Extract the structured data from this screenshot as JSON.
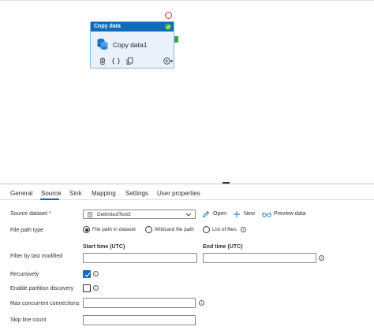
{
  "activity": {
    "type_label": "Copy data",
    "name": "Copy data1"
  },
  "tabs": [
    {
      "label": "General"
    },
    {
      "label": "Source"
    },
    {
      "label": "Sink"
    },
    {
      "label": "Mapping"
    },
    {
      "label": "Settings"
    },
    {
      "label": "User properties"
    }
  ],
  "active_tab": "Source",
  "source": {
    "dataset_label": "Source dataset",
    "required_mark": "*",
    "dataset_value": "DelimitedText3",
    "open_label": "Open",
    "new_label": "New",
    "preview_label": "Preview data",
    "file_path_type_label": "File path type",
    "file_path_options": [
      {
        "label": "File path in dataset",
        "checked": true
      },
      {
        "label": "Wildcard file path",
        "checked": false
      },
      {
        "label": "List of files",
        "checked": false
      }
    ],
    "filter_label": "Filter by last modified",
    "start_time_label": "Start time (UTC)",
    "end_time_label": "End time (UTC)",
    "start_time_value": "",
    "end_time_value": "",
    "recursively_label": "Recursively",
    "recursively_checked": true,
    "partition_discovery_label": "Enable partition discovery",
    "partition_discovery_checked": false,
    "max_connections_label": "Max concurrent connections",
    "max_connections_value": "",
    "skip_line_count_label": "Skip line count",
    "skip_line_count_value": ""
  },
  "colors": {
    "accent": "#0f6cbd",
    "success": "#3ea33e",
    "error_ring": "#d13438"
  },
  "icons": {
    "activity_check": "check-circle-icon",
    "activity": "copy-data-icon",
    "delete": "trash-icon",
    "code": "code-icon",
    "clone": "copy-icon",
    "add_output": "add-output-icon",
    "dataset": "dataset-icon",
    "open": "pencil-icon",
    "new": "plus-icon",
    "preview": "glasses-icon",
    "info": "info-icon",
    "dropdown": "chevron-down-icon"
  }
}
